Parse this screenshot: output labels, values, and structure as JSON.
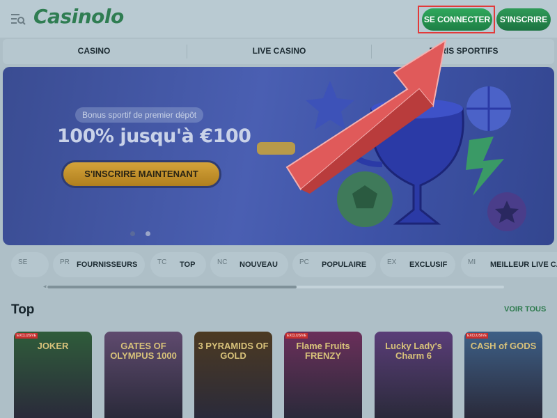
{
  "header": {
    "logo": "Casinolo",
    "login_label": "SE CONNECTER",
    "signup_label": "S'INSCRIRE"
  },
  "nav": {
    "items": [
      "CASINO",
      "LIVE CASINO",
      "PARIS SPORTIFS"
    ]
  },
  "banner": {
    "subtitle": "Bonus sportif de premier dépôt",
    "title": "100% jusqu'à €100",
    "cta_label": "S'INSCRIRE MAINTENANT"
  },
  "categories": [
    {
      "img_alt": "SE",
      "label": ""
    },
    {
      "img_alt": "PR",
      "label": "FOURNISSEURS"
    },
    {
      "img_alt": "TC",
      "label": "TOP"
    },
    {
      "img_alt": "NC",
      "label": "NOUVEAU"
    },
    {
      "img_alt": "PC",
      "label": "POPULAIRE"
    },
    {
      "img_alt": "EX",
      "label": "EXCLUSIF"
    },
    {
      "img_alt": "MI",
      "label": "MEILLEUR LIVE CA"
    }
  ],
  "section": {
    "title": "Top",
    "see_all": "VOIR TOUS"
  },
  "games": [
    {
      "title": "JOKER",
      "badge": "EXCLUSIVE",
      "color": "#2f5c3a"
    },
    {
      "title": "GATES OF OLYMPUS 1000",
      "badge": "",
      "color": "#5f4a6e"
    },
    {
      "title": "3 PYRAMIDS OF GOLD",
      "badge": "",
      "color": "#4c3a22"
    },
    {
      "title": "Flame Fruits FRENZY",
      "badge": "EXCLUSIVE",
      "color": "#6a2f5a"
    },
    {
      "title": "Lucky Lady's Charm 6",
      "badge": "",
      "color": "#5a3d78"
    },
    {
      "title": "CASH of GODS",
      "badge": "EXCLUSIVE",
      "color": "#3d5f86"
    }
  ],
  "colors": {
    "accent_green": "#2fa85c",
    "highlight_red": "#e23a3a",
    "arrow_red": "#d9534f"
  }
}
